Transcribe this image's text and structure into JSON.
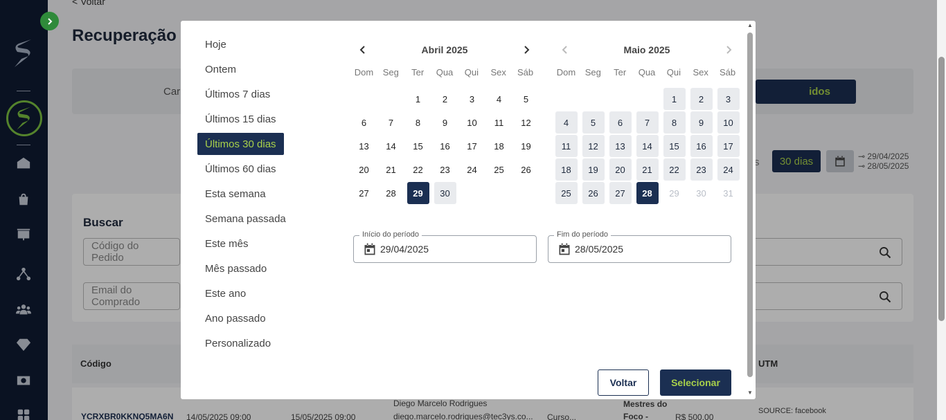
{
  "background": {
    "back_link": "< Voltar",
    "page_title": "Recuperação",
    "card_text": "Car",
    "navy_button_text": "idos",
    "range_partial": "s",
    "range_button": "30 dias",
    "range_start": "29/04/2025",
    "range_end": "28/05/2025",
    "search_title": "Buscar",
    "search_order_placeholder": "Código do Pedido",
    "search_email_placeholder": "Email do Comprado",
    "col_code": "Código",
    "col_utm": "UTM",
    "row": {
      "code": "YCRXBR0KKNQ5MA6N",
      "date1": "14/05/2025 09:00",
      "date2": "15/05/2025 09:00",
      "name": "Diego Marcelo Rodrigues",
      "email": "diego.marcelo.rodrigues@tec3ys.co...",
      "course": "Curso...",
      "product": "Mestres do",
      "product2": "Foco -",
      "price": "R$ 500,00",
      "utm": "SOURCE: facebook"
    }
  },
  "modal": {
    "presets": [
      {
        "label": "Hoje",
        "active": false
      },
      {
        "label": "Ontem",
        "active": false
      },
      {
        "label": "Últimos 7 dias",
        "active": false
      },
      {
        "label": "Últimos 15 dias",
        "active": false
      },
      {
        "label": "Últimos 30 dias",
        "active": true
      },
      {
        "label": "Últimos 60 dias",
        "active": false
      },
      {
        "label": "Esta semana",
        "active": false
      },
      {
        "label": "Semana passada",
        "active": false
      },
      {
        "label": "Este mês",
        "active": false
      },
      {
        "label": "Mês passado",
        "active": false
      },
      {
        "label": "Este ano",
        "active": false
      },
      {
        "label": "Ano passado",
        "active": false
      },
      {
        "label": "Personalizado",
        "active": false
      }
    ],
    "weekdays": [
      "Dom",
      "Seg",
      "Ter",
      "Qua",
      "Qui",
      "Sex",
      "Sáb"
    ],
    "months": [
      {
        "title": "Abril 2025",
        "offset": 2,
        "days": 30,
        "range_start": 29,
        "range_end": 30,
        "selected": [
          29
        ],
        "disabled_from": 99
      },
      {
        "title": "Maio 2025",
        "offset": 4,
        "days": 31,
        "range_start": 1,
        "range_end": 28,
        "selected": [
          28
        ],
        "disabled_from": 29
      }
    ],
    "start_label": "Início do período",
    "start_value": "29/04/2025",
    "end_label": "Fim do período",
    "end_value": "28/05/2025",
    "back_button": "Voltar",
    "select_button": "Selecionar"
  },
  "colors": {
    "navy": "#1b2f52",
    "accent_green": "#a8d04a",
    "sidebar": "#0f1b33"
  }
}
